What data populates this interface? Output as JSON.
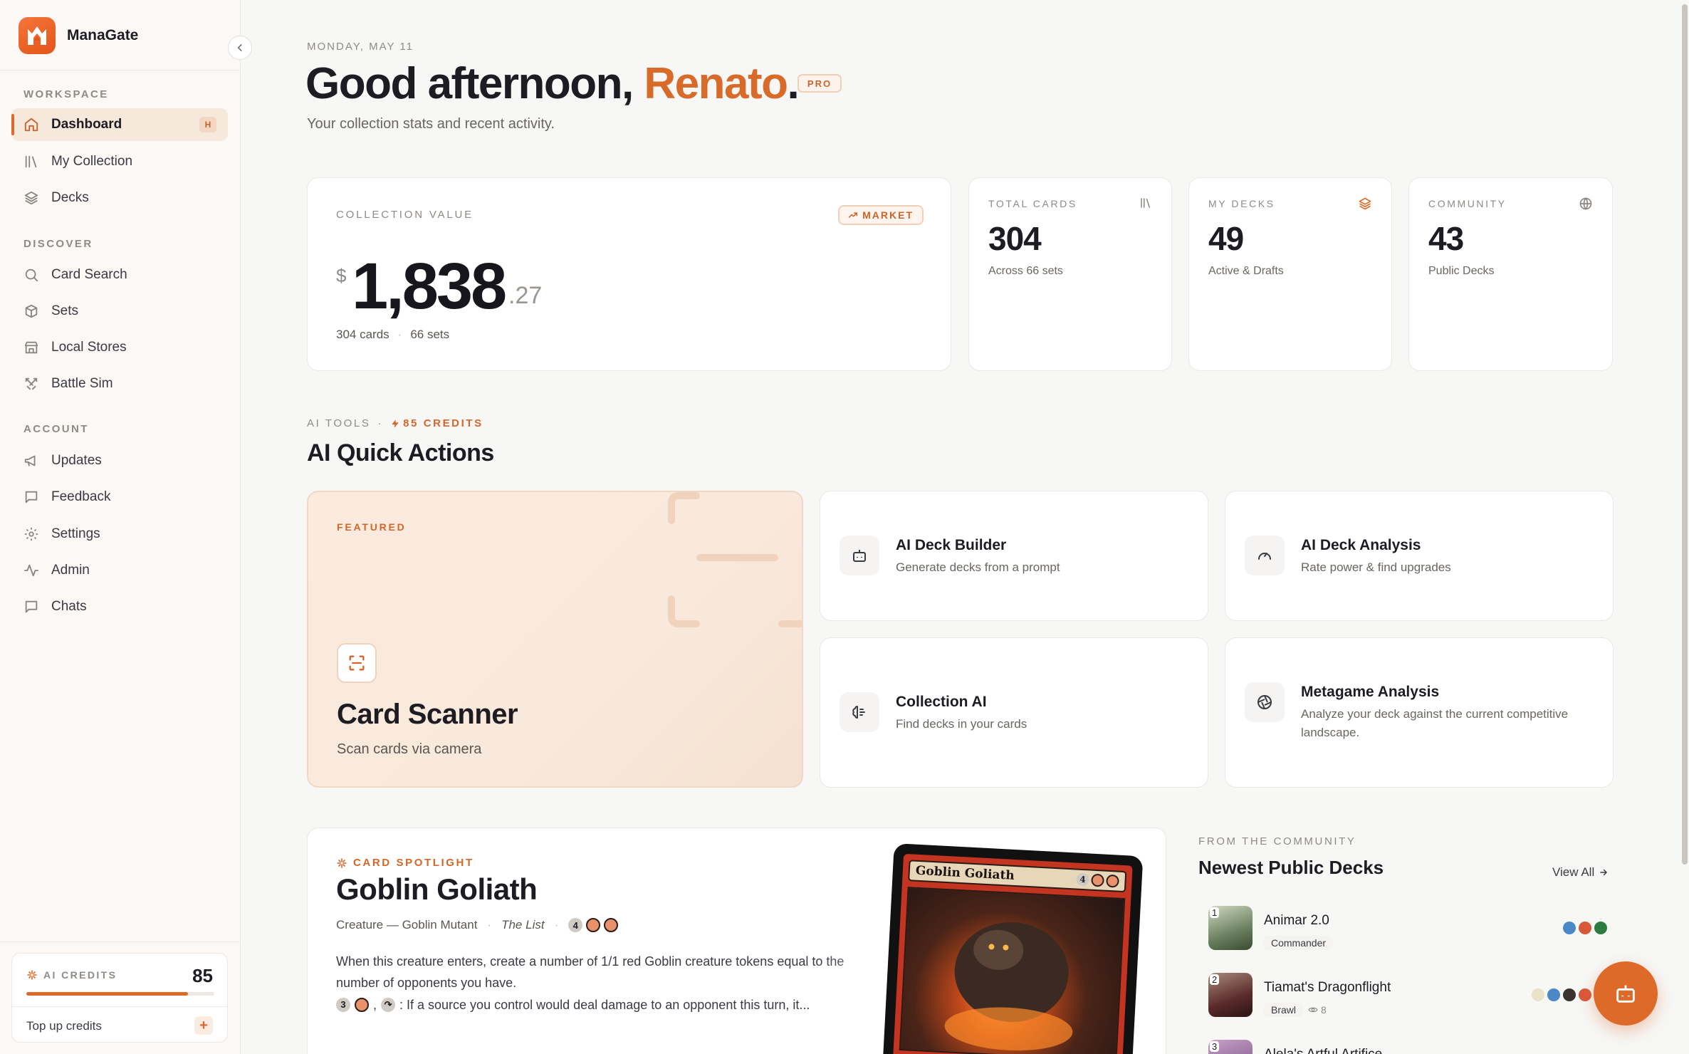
{
  "app": {
    "name": "ManaGate"
  },
  "sidebar": {
    "sections": [
      {
        "label": "WORKSPACE"
      },
      {
        "label": "DISCOVER"
      },
      {
        "label": "ACCOUNT"
      }
    ],
    "items": [
      {
        "label": "Dashboard",
        "icon": "home-icon",
        "shortcut": "H",
        "active": true
      },
      {
        "label": "My Collection",
        "icon": "library-icon"
      },
      {
        "label": "Decks",
        "icon": "layers-icon"
      },
      {
        "label": "Card Search",
        "icon": "search-icon"
      },
      {
        "label": "Sets",
        "icon": "box-icon"
      },
      {
        "label": "Local Stores",
        "icon": "store-icon"
      },
      {
        "label": "Battle Sim",
        "icon": "swords-icon"
      },
      {
        "label": "Updates",
        "icon": "megaphone-icon"
      },
      {
        "label": "Feedback",
        "icon": "message-icon"
      },
      {
        "label": "Settings",
        "icon": "gear-icon"
      },
      {
        "label": "Admin",
        "icon": "activity-icon"
      },
      {
        "label": "Chats",
        "icon": "chat-icon"
      }
    ],
    "credits": {
      "label": "AI CREDITS",
      "value": "85",
      "fill": 0.86,
      "topup_label": "Top up credits",
      "topup_symbol": "+"
    }
  },
  "header": {
    "date": "MONDAY, MAY 11",
    "greeting_prefix": "Good afternoon, ",
    "greeting_name": "Renato",
    "greeting_suffix": ".",
    "badge": "PRO",
    "subtitle": "Your collection stats and recent activity."
  },
  "stats": {
    "collection": {
      "label": "COLLECTION VALUE",
      "badge": "MARKET",
      "currency": "$",
      "value": "1,838",
      "cents": ".27",
      "cards": "304 cards",
      "sets": "66 sets",
      "separator": "·"
    },
    "cards": [
      {
        "label": "TOTAL CARDS",
        "value": "304",
        "sub": "Across 66 sets",
        "icon": "library-icon"
      },
      {
        "label": "MY DECKS",
        "value": "49",
        "sub": "Active & Drafts",
        "icon": "layers-icon"
      },
      {
        "label": "COMMUNITY",
        "value": "43",
        "sub": "Public Decks",
        "icon": "globe-icon"
      }
    ]
  },
  "ai": {
    "section_label": "AI TOOLS",
    "separator": "·",
    "credits": "85 CREDITS",
    "heading": "AI Quick Actions",
    "featured": {
      "label": "FEATURED",
      "title": "Card Scanner",
      "sub": "Scan cards via camera"
    },
    "actions": [
      {
        "title": "AI Deck Builder",
        "sub": "Generate decks from a prompt",
        "icon": "robot-icon"
      },
      {
        "title": "AI Deck Analysis",
        "sub": "Rate power & find upgrades",
        "icon": "gauge-icon"
      },
      {
        "title": "Collection AI",
        "sub": "Find decks in your cards",
        "icon": "brain-icon"
      },
      {
        "title": "Metagame Analysis",
        "sub": "Analyze your deck against the current competitive landscape.",
        "icon": "aperture-icon"
      }
    ]
  },
  "spotlight": {
    "label": "CARD SPOTLIGHT",
    "title": "Goblin Goliath",
    "type_line": "Creature — Goblin Mutant",
    "separator": "·",
    "set": "The List",
    "mana_generic": "4",
    "text": "When this creature enters, create a number of 1/1 red Goblin creature tokens equal to the number of opponents you have.",
    "ability_cost": "3",
    "ability_text": ": If a source you control would deal damage to an opponent this turn, it...",
    "card_name": "Goblin Goliath",
    "card_cost": "4"
  },
  "community": {
    "label": "FROM THE COMMUNITY",
    "heading": "Newest Public Decks",
    "view_all": "View All",
    "decks": [
      {
        "rank": "1",
        "name": "Animar 2.0",
        "format": "Commander",
        "views": "",
        "colors": [
          "#4a88c7",
          "#d8583a",
          "#2c7b3f"
        ]
      },
      {
        "rank": "2",
        "name": "Tiamat's Dragonflight",
        "format": "Brawl",
        "views": "8",
        "colors": [
          "#e8e2c8",
          "#4a88c7",
          "#3a3330",
          "#d8583a",
          "#2c7b3f"
        ]
      },
      {
        "rank": "3",
        "name": "Alela's Artful Artifice",
        "format": "",
        "views": "",
        "colors": []
      }
    ]
  }
}
